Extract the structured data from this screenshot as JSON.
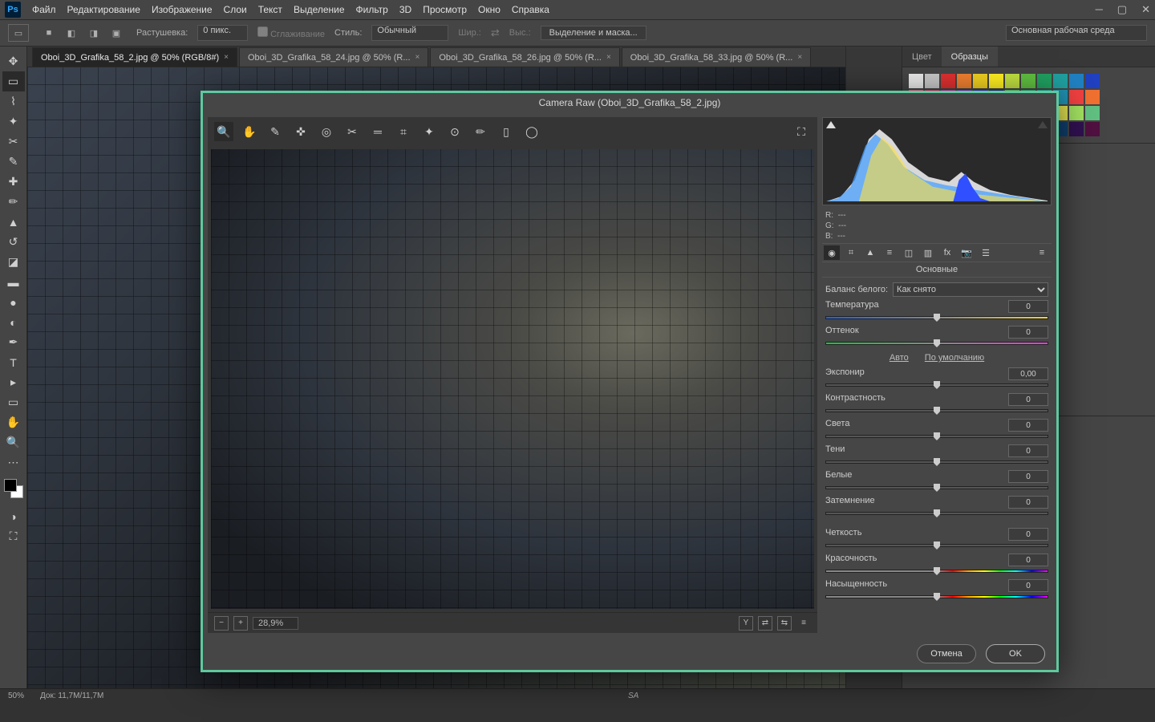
{
  "menu": [
    "Файл",
    "Редактирование",
    "Изображение",
    "Слои",
    "Текст",
    "Выделение",
    "Фильтр",
    "3D",
    "Просмотр",
    "Окно",
    "Справка"
  ],
  "optionsbar": {
    "feather_label": "Растушевка:",
    "feather_value": "0 пикс.",
    "antialias": "Сглаживание",
    "style_label": "Стиль:",
    "style_value": "Обычный",
    "width_label": "Шир.:",
    "height_label": "Выс.:",
    "select_mask": "Выделение и маска...",
    "workspace": "Основная рабочая среда"
  },
  "tabs": [
    {
      "label": "Oboi_3D_Grafika_58_2.jpg @ 50% (RGB/8#)",
      "active": true
    },
    {
      "label": "Oboi_3D_Grafika_58_24.jpg @ 50% (R...",
      "active": false
    },
    {
      "label": "Oboi_3D_Grafika_58_26.jpg @ 50% (R...",
      "active": false
    },
    {
      "label": "Oboi_3D_Grafika_58_33.jpg @ 50% (R...",
      "active": false
    }
  ],
  "status": {
    "zoom": "50%",
    "doc": "Док: 11,7M/11,7M",
    "sig": "SA"
  },
  "right_panel": {
    "tab_color": "Цвет",
    "tab_swatches": "Образцы"
  },
  "swatch_colors": [
    "#eaeaea",
    "#c8c8c8",
    "#e03030",
    "#f08030",
    "#f0d020",
    "#fff020",
    "#c0e040",
    "#60c040",
    "#20a060",
    "#20a0a0",
    "#2080c0",
    "#2040c0",
    "#f05080",
    "#e02060",
    "#c020a0",
    "#8020c0",
    "#4020c0",
    "#202080",
    "#60c060",
    "#30a070",
    "#20a090",
    "#2090b0",
    "#f04040",
    "#f07030",
    "#f0b020",
    "#d0e030",
    "#90d040",
    "#40b060",
    "#20a080",
    "#2090a0",
    "#f06060",
    "#f08850",
    "#f0c040",
    "#e0e050",
    "#a0e060",
    "#60c080",
    "#30b0a0",
    "#3090c0",
    "#801010",
    "#a03010",
    "#a07010",
    "#809010",
    "#508020",
    "#206040",
    "#105050",
    "#104070",
    "#301050",
    "#501040"
  ],
  "craw_title": "Camera Raw (Oboi_3D_Grafika_58_2.jpg)",
  "craw": {
    "zoom_pct": "28,9%",
    "rgb": {
      "r_label": "R:",
      "g_label": "G:",
      "b_label": "B:",
      "dash": "---"
    },
    "panel_title": "Основные",
    "wb_label": "Баланс белого:",
    "wb_value": "Как снято",
    "auto": "Авто",
    "default": "По умолчанию",
    "sliders": {
      "temp": {
        "label": "Температура",
        "value": "0"
      },
      "tint": {
        "label": "Оттенок",
        "value": "0"
      },
      "exposure": {
        "label": "Экспонир",
        "value": "0,00"
      },
      "contrast": {
        "label": "Контрастность",
        "value": "0"
      },
      "highlights": {
        "label": "Света",
        "value": "0"
      },
      "shadows": {
        "label": "Тени",
        "value": "0"
      },
      "whites": {
        "label": "Белые",
        "value": "0"
      },
      "blacks": {
        "label": "Затемнение",
        "value": "0"
      },
      "clarity": {
        "label": "Четкость",
        "value": "0"
      },
      "vibrance": {
        "label": "Красочность",
        "value": "0"
      },
      "saturation": {
        "label": "Насыщенность",
        "value": "0"
      }
    },
    "cancel": "Отмена",
    "ok": "OK"
  }
}
